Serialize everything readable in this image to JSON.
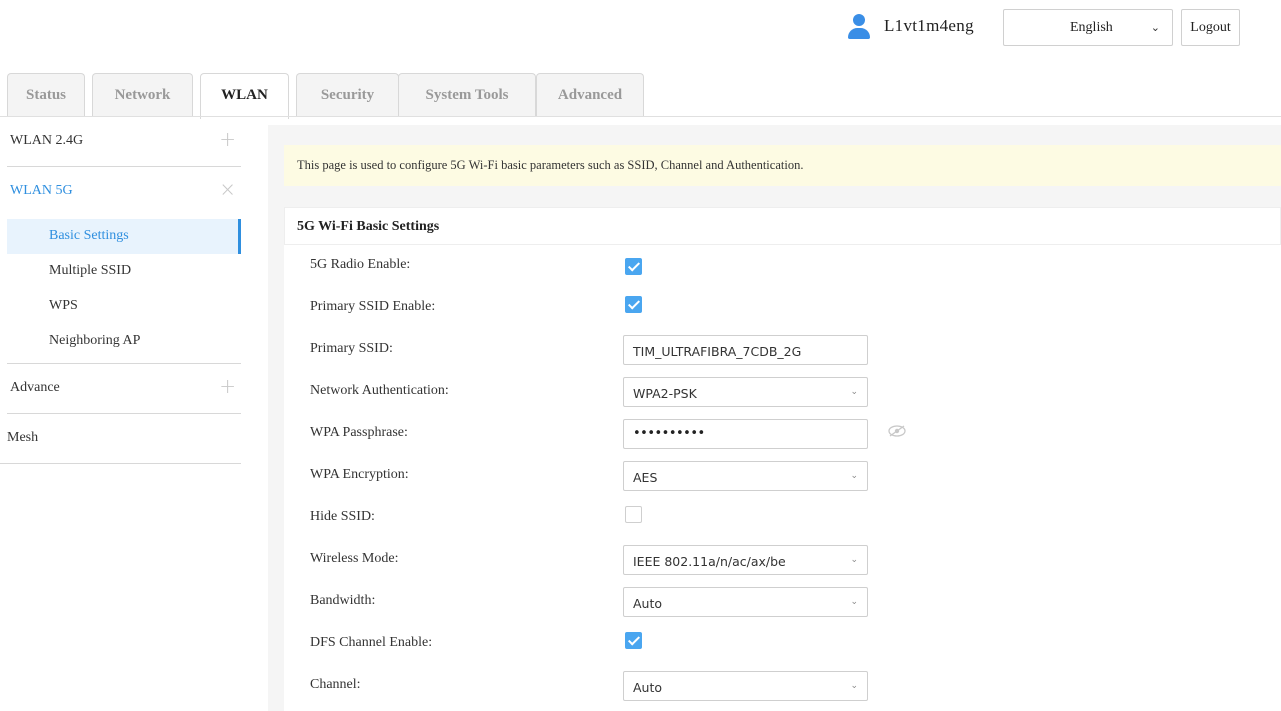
{
  "header": {
    "username": "L1vt1m4eng",
    "language": "English",
    "logout_label": "Logout"
  },
  "tabs": [
    {
      "label": "Status"
    },
    {
      "label": "Network"
    },
    {
      "label": "WLAN"
    },
    {
      "label": "Security"
    },
    {
      "label": "System Tools"
    },
    {
      "label": "Advanced"
    }
  ],
  "sidebar": {
    "groups": [
      {
        "label": "WLAN 2.4G",
        "sign": "+"
      },
      {
        "label": "WLAN 5G",
        "sign": "×"
      },
      {
        "label": "Advance",
        "sign": "+"
      },
      {
        "label": "Mesh"
      }
    ],
    "sub_items": [
      {
        "label": "Basic Settings"
      },
      {
        "label": "Multiple SSID"
      },
      {
        "label": "WPS"
      },
      {
        "label": "Neighboring AP"
      }
    ]
  },
  "main": {
    "notice": "This page is used to configure 5G Wi-Fi basic parameters such as SSID, Channel and Authentication.",
    "section_title": "5G Wi-Fi Basic Settings",
    "fields": {
      "radio_enable": {
        "label": "5G Radio Enable:",
        "checked": true
      },
      "primary_ssid_enable": {
        "label": "Primary SSID Enable:",
        "checked": true
      },
      "primary_ssid": {
        "label": "Primary SSID:",
        "value": "TIM_ULTRAFIBRA_7CDB_2G"
      },
      "network_auth": {
        "label": "Network Authentication:",
        "value": "WPA2-PSK"
      },
      "wpa_passphrase": {
        "label": "WPA Passphrase:",
        "value": "••••••••••"
      },
      "wpa_encryption": {
        "label": "WPA Encryption:",
        "value": "AES"
      },
      "hide_ssid": {
        "label": "Hide SSID:",
        "checked": false
      },
      "wireless_mode": {
        "label": "Wireless Mode:",
        "value": "IEEE 802.11a/n/ac/ax/be"
      },
      "bandwidth": {
        "label": "Bandwidth:",
        "value": "Auto"
      },
      "dfs_channel_enable": {
        "label": "DFS Channel Enable:",
        "checked": true
      },
      "channel": {
        "label": "Channel:",
        "value": "Auto"
      }
    }
  },
  "icons": {
    "chevron": "⌄",
    "user": "user-icon",
    "eye": "eye-off-icon"
  },
  "colors": {
    "accent": "#2f8fdf",
    "checkbox": "#4aa6f0",
    "notice_bg": "#fdfbe3"
  }
}
